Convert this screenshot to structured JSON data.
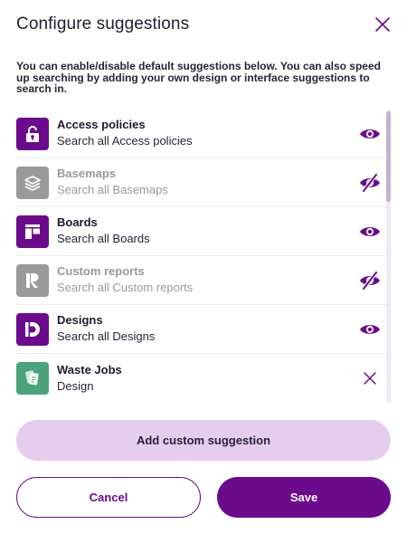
{
  "dialog": {
    "title": "Configure suggestions",
    "description": "You can enable/disable default suggestions below. You can also speed up searching by adding your own design or interface suggestions to search in."
  },
  "colors": {
    "accent": "#6b0b8c",
    "disabled_icon_bg": "#9a9a9a",
    "design_icon_bg": "#4aa37a",
    "add_button_bg": "#e6cdee"
  },
  "suggestions": [
    {
      "title": "Access policies",
      "subtitle": "Search all Access policies",
      "icon": "access-policy-icon",
      "state": "enabled",
      "action_icon": "eye-icon"
    },
    {
      "title": "Basemaps",
      "subtitle": "Search all Basemaps",
      "icon": "layers-icon",
      "state": "disabled",
      "action_icon": "eye-off-icon"
    },
    {
      "title": "Boards",
      "subtitle": "Search all Boards",
      "icon": "board-icon",
      "state": "enabled",
      "action_icon": "eye-icon"
    },
    {
      "title": "Custom reports",
      "subtitle": "Search all Custom reports",
      "icon": "report-icon",
      "state": "disabled",
      "action_icon": "eye-off-icon"
    },
    {
      "title": "Designs",
      "subtitle": "Search all Designs",
      "icon": "design-icon",
      "state": "enabled",
      "action_icon": "eye-icon"
    },
    {
      "title": "Waste Jobs",
      "subtitle": "Design",
      "icon": "waste-jobs-icon",
      "state": "custom",
      "action_icon": "remove-icon"
    }
  ],
  "buttons": {
    "add_custom": "Add custom suggestion",
    "cancel": "Cancel",
    "save": "Save"
  }
}
